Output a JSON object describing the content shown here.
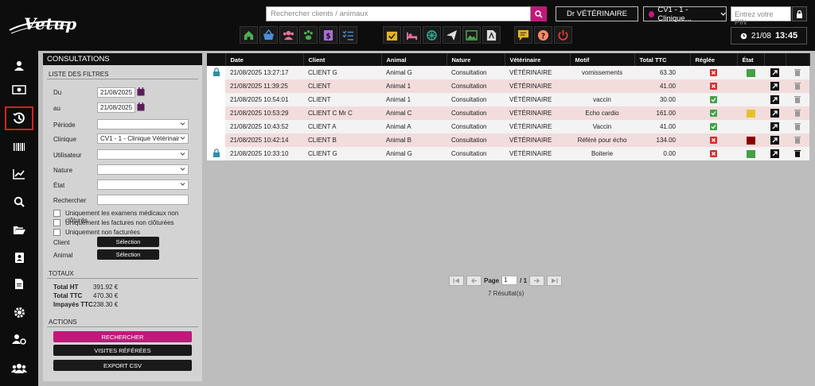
{
  "brand": {
    "name": "Vetup"
  },
  "header": {
    "search_placeholder": "Rechercher clients / animaux",
    "vet_label": "Dr VÉTÉRINAIRE",
    "clinic_label": "CV1 - 1 - Clinique...",
    "pin_placeholder": "Entrez votre PIN",
    "date": "21/08",
    "time": "13:45"
  },
  "toolbar_icons": [
    {
      "name": "home-icon",
      "color": "#4caf50"
    },
    {
      "name": "basket-icon",
      "color": "#4a90d9"
    },
    {
      "name": "users-icon",
      "color": "#e5739d"
    },
    {
      "name": "paw-icon",
      "color": "#4caf50"
    },
    {
      "name": "dollar-icon",
      "color": "#b06ad8"
    },
    {
      "name": "tasks-icon",
      "color": "#4a90d9"
    },
    {
      "name": "calendar-check-icon",
      "color": "#e6b422"
    },
    {
      "name": "bed-icon",
      "color": "#e5739d"
    },
    {
      "name": "network-icon",
      "color": "#2bb39a"
    },
    {
      "name": "send-icon",
      "color": "#dddddd"
    },
    {
      "name": "image-icon",
      "color": "#4caf50"
    },
    {
      "name": "pdf-icon",
      "color": "#dddddd"
    },
    {
      "name": "message-icon",
      "color": "#e6b422"
    },
    {
      "name": "help-icon",
      "color": "#ff8a65"
    },
    {
      "name": "power-icon",
      "color": "#e53935"
    }
  ],
  "panel": {
    "title": "CONSULTATIONS",
    "filters_title": "LISTE DES FILTRES",
    "du_label": "Du",
    "du_value": "21/08/2025",
    "au_label": "au",
    "au_value": "21/08/2025",
    "periode_label": "Période",
    "clinique_label": "Clinique",
    "clinique_value": "CV1 - 1 - Clinique Vétérinair",
    "utilisateur_label": "Utilisateur",
    "nature_label": "Nature",
    "etat_label": "État",
    "rechercher_label": "Rechercher",
    "chk1": "Uniquement les examens médicaux non clôturés",
    "chk2": "Uniquement les factures non clôturées",
    "chk3": "Uniquement non facturées",
    "client_label": "Client",
    "animal_label": "Animal",
    "selection": "Sélection",
    "totaux_title": "TOTAUX",
    "total_ht_label": "Total HT",
    "total_ht": "391.92 €",
    "total_ttc_label": "Total TTC",
    "total_ttc": "470.30 €",
    "impayes_label": "Impayés TTC",
    "impayes": "238.30 €",
    "actions_title": "ACTIONS",
    "btn_rechercher": "RECHERCHER",
    "btn_visites": "VISITES RÉFÉRÉES",
    "btn_export": "EXPORT CSV"
  },
  "table": {
    "headers": [
      "",
      "Date",
      "Client",
      "Animal",
      "Nature",
      "Vétérinaire",
      "Motif",
      "Total TTC",
      "Réglée",
      "État",
      "",
      ""
    ],
    "rows": [
      {
        "locked": true,
        "date": "21/08/2025 13:27:17",
        "client": "CLIENT G",
        "animal": "Animal G",
        "nature": "Consultation",
        "vet": "VÉTÉRINAIRE",
        "motif": "vomissements",
        "total": "63.30",
        "paid": false,
        "state": "#43a047",
        "trash": "#999"
      },
      {
        "locked": false,
        "date": "21/08/2025 11:39:25",
        "client": "CLIENT",
        "animal": "Animal 1",
        "nature": "Consultation",
        "vet": "VÉTÉRINAIRE",
        "motif": "",
        "total": "41.00",
        "paid": false,
        "state": "",
        "trash": "#999"
      },
      {
        "locked": false,
        "date": "21/08/2025 10:54:01",
        "client": "CLIENT",
        "animal": "Animal 1",
        "nature": "Consultation",
        "vet": "VÉTÉRINAIRE",
        "motif": "vaccin",
        "total": "30.00",
        "paid": true,
        "state": "",
        "trash": "#999"
      },
      {
        "locked": false,
        "date": "21/08/2025 10:53:29",
        "client": "CLIENT C Mr C",
        "animal": "Animal C",
        "nature": "Consultation",
        "vet": "VÉTÉRINAIRE",
        "motif": "Echo cardio",
        "total": "161.00",
        "paid": true,
        "state": "#e6c229",
        "trash": "#999"
      },
      {
        "locked": false,
        "date": "21/08/2025 10:43:52",
        "client": "CLIENT A",
        "animal": "Animal A",
        "nature": "Consultation",
        "vet": "VÉTÉRINAIRE",
        "motif": "Vaccin",
        "total": "41.00",
        "paid": true,
        "state": "",
        "trash": "#999"
      },
      {
        "locked": false,
        "date": "21/08/2025 10:42:14",
        "client": "CLIENT B",
        "animal": "Animal B",
        "nature": "Consultation",
        "vet": "VÉTÉRINAIRE",
        "motif": "Référé pour écho",
        "total": "134.00",
        "paid": false,
        "state": "#8b0000",
        "trash": "#999"
      },
      {
        "locked": true,
        "date": "21/08/2025 10:33:10",
        "client": "CLIENT G",
        "animal": "Animal G",
        "nature": "Consultation",
        "vet": "VÉTÉRINAIRE",
        "motif": "Boiterie",
        "total": "0.00",
        "paid": false,
        "state": "#43a047",
        "trash": "#111"
      }
    ]
  },
  "pager": {
    "page_label": "Page",
    "page_value": "1",
    "of": "/ 1",
    "results": "7 Résultat(s)"
  },
  "colors": {
    "accent": "#c2187a",
    "topbar": "#0d0d0d",
    "active_outline": "#d92020"
  }
}
